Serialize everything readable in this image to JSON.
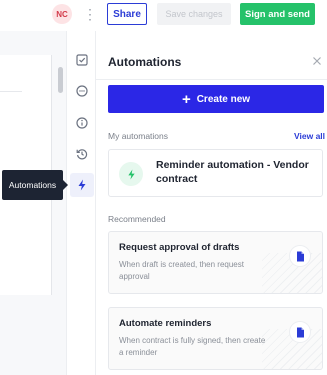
{
  "header": {
    "avatar_initials": "NC",
    "share_label": "Share",
    "save_label": "Save changes",
    "sign_label": "Sign and send"
  },
  "rail": {
    "icons": [
      "checkbox-icon",
      "comment-icon",
      "info-icon",
      "history-icon",
      "bolt-icon"
    ],
    "active": "bolt-icon",
    "tooltip": "Automations"
  },
  "panel": {
    "title": "Automations",
    "create_label": "Create new",
    "my_automations_label": "My automations",
    "view_all_label": "View all",
    "my_automations": [
      {
        "title": "Reminder automation - Vendor contract"
      }
    ],
    "recommended_label": "Recommended",
    "recommended": [
      {
        "title": "Request approval of drafts",
        "description": "When draft is created, then request approval"
      },
      {
        "title": "Automate reminders",
        "description": "When contract is fully signed, then create a reminder"
      }
    ]
  },
  "colors": {
    "primary": "#2b27e6",
    "accent_blue": "#2b3cd6",
    "success": "#25c26a",
    "tooltip_bg": "#1d2433"
  }
}
